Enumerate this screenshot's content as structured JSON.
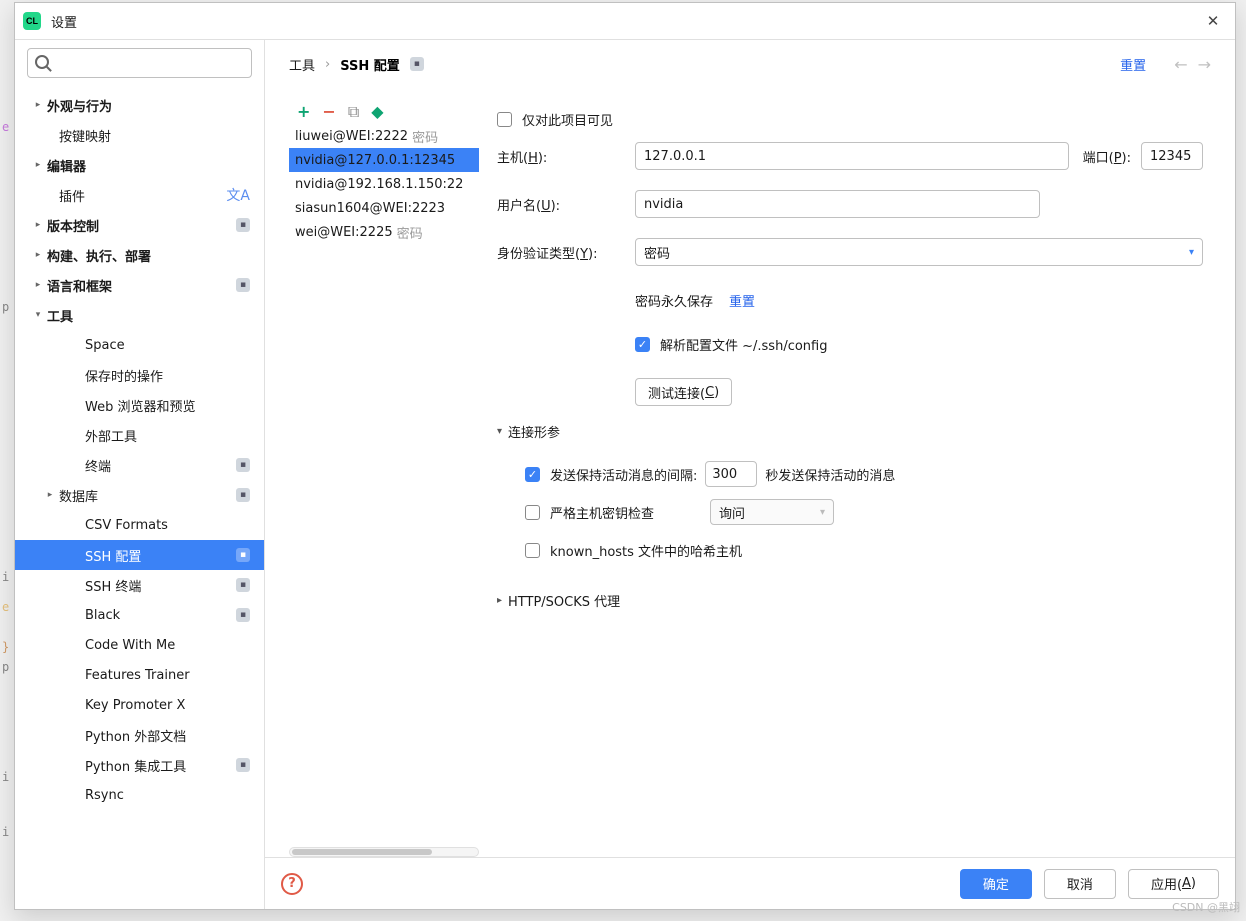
{
  "window": {
    "title": "设置"
  },
  "search": {
    "placeholder": ""
  },
  "sidebar": [
    {
      "label": "外观与行为",
      "bold": true,
      "chev": ">"
    },
    {
      "label": "按键映射",
      "depth": 1
    },
    {
      "label": "编辑器",
      "bold": true,
      "chev": ">"
    },
    {
      "label": "插件",
      "depth": 1,
      "lang": true
    },
    {
      "label": "版本控制",
      "bold": true,
      "chev": ">",
      "badge": true
    },
    {
      "label": "构建、执行、部署",
      "bold": true,
      "chev": ">"
    },
    {
      "label": "语言和框架",
      "bold": true,
      "chev": ">",
      "badge": true
    },
    {
      "label": "工具",
      "bold": true,
      "chev": "v"
    },
    {
      "label": "Space",
      "depth": 2
    },
    {
      "label": "保存时的操作",
      "depth": 2
    },
    {
      "label": "Web 浏览器和预览",
      "depth": 2
    },
    {
      "label": "外部工具",
      "depth": 2
    },
    {
      "label": "终端",
      "depth": 2,
      "badge": true
    },
    {
      "label": "数据库",
      "depth": 1,
      "chev": ">",
      "badge": true
    },
    {
      "label": "CSV Formats",
      "depth": 2
    },
    {
      "label": "SSH 配置",
      "depth": 2,
      "badge": true,
      "selected": true
    },
    {
      "label": "SSH 终端",
      "depth": 2,
      "badge": true
    },
    {
      "label": "Black",
      "depth": 2,
      "badge": true
    },
    {
      "label": "Code With Me",
      "depth": 2
    },
    {
      "label": "Features Trainer",
      "depth": 2
    },
    {
      "label": "Key Promoter X",
      "depth": 2
    },
    {
      "label": "Python 外部文档",
      "depth": 2
    },
    {
      "label": "Python 集成工具",
      "depth": 2,
      "badge": true
    },
    {
      "label": "Rsync",
      "depth": 2
    }
  ],
  "breadcrumb": {
    "root": "工具",
    "sep": "›",
    "current": "SSH 配置"
  },
  "header": {
    "reset": "重置"
  },
  "ssh_list": [
    {
      "main": "liuwei@WEI:2222",
      "suffix": "密码"
    },
    {
      "main": "nvidia@127.0.0.1:12345",
      "suffix": "",
      "selected": true
    },
    {
      "main": "nvidia@192.168.1.150:22",
      "suffix": ""
    },
    {
      "main": "siasun1604@WEI:2223",
      "suffix": ""
    },
    {
      "main": "wei@WEI:2225",
      "suffix": "密码"
    }
  ],
  "form": {
    "project_only": "仅对此项目可见",
    "host_label_pre": "主机(",
    "host_label_u": "H",
    "host_label_post": "):",
    "host_value": "127.0.0.1",
    "port_label_pre": "端口(",
    "port_label_u": "P",
    "port_label_post": "):",
    "port_value": "12345",
    "user_label_pre": "用户名(",
    "user_label_u": "U",
    "user_label_post": "):",
    "user_value": "nvidia",
    "auth_label_pre": "身份验证类型(",
    "auth_label_u": "Y",
    "auth_label_post": "):",
    "auth_value": "密码",
    "pwd_saved": "密码永久保存",
    "pwd_reset": "重置",
    "parse_config": "解析配置文件 ~/.ssh/config",
    "test_conn_pre": "测试连接(",
    "test_conn_u": "C",
    "test_conn_post": ")",
    "conn_section": "连接形参",
    "keepalive_prefix": "发送保持活动消息的间隔:",
    "keepalive_value": "300",
    "keepalive_suffix": "秒发送保持活动的消息",
    "strict_host": "严格主机密钥检查",
    "strict_value": "询问",
    "known_hosts": "known_hosts 文件中的哈希主机",
    "proxy_section": "HTTP/SOCKS 代理"
  },
  "footer": {
    "ok": "确定",
    "cancel": "取消",
    "apply_pre": "应用(",
    "apply_u": "A",
    "apply_post": ")"
  },
  "watermark": "CSDN @黑翊"
}
